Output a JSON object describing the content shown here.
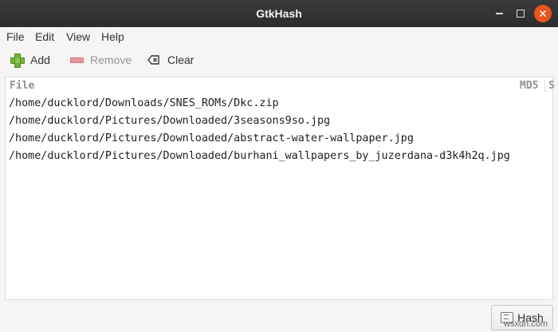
{
  "window": {
    "title": "GtkHash",
    "controls": {
      "minimize": "–",
      "maximize": "□",
      "close": "✕"
    }
  },
  "menu": [
    "File",
    "Edit",
    "View",
    "Help"
  ],
  "toolbar": {
    "add_label": "Add",
    "remove_label": "Remove",
    "clear_label": "Clear"
  },
  "list": {
    "columns": [
      "File",
      "MD5",
      "S"
    ],
    "rows": [
      "/home/ducklord/Downloads/SNES_ROMs/Dkc.zip",
      "/home/ducklord/Pictures/Downloaded/3seasons9so.jpg",
      "/home/ducklord/Pictures/Downloaded/abstract-water-wallpaper.jpg",
      "/home/ducklord/Pictures/Downloaded/burhani_wallpapers_by_juzerdana-d3k4h2q.jpg"
    ]
  },
  "hash_button": {
    "label": "Hash"
  },
  "watermark": "wsxdn.com",
  "colors": {
    "titlebar": "#2c2c2c",
    "close_button": "#e95420",
    "add_icon": "#73b33a",
    "remove_icon": "#e59a9a"
  }
}
